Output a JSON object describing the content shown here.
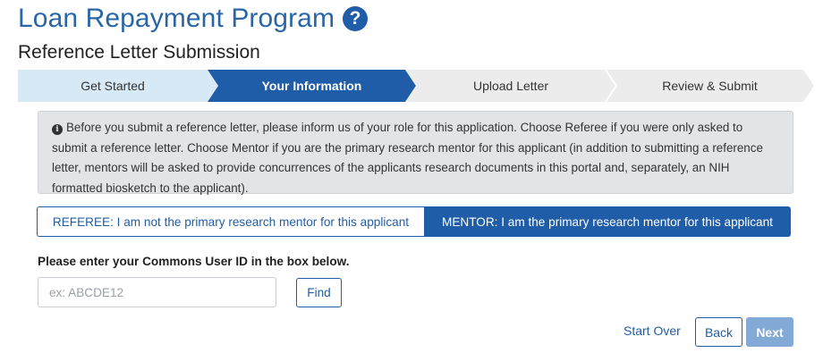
{
  "page": {
    "title": "Loan Repayment Program",
    "help_icon": "question-circle-icon",
    "subtitle": "Reference Letter Submission"
  },
  "stepper": {
    "steps": [
      {
        "label": "Get Started",
        "state": "completed"
      },
      {
        "label": "Your Information",
        "state": "active"
      },
      {
        "label": "Upload Letter",
        "state": "pending"
      },
      {
        "label": "Review & Submit",
        "state": "pending"
      }
    ],
    "colors": {
      "completed": "#d6e9f4",
      "active": "#1f5da8",
      "pending": "#ececec"
    }
  },
  "info": {
    "icon": "info-circle-icon",
    "text": "Before you submit a reference letter, please inform us of your role for this application. Choose Referee if you were only asked to submit a reference letter. Choose Mentor if you are the primary research mentor for this applicant (in addition to submitting a reference letter, mentors will be asked to provide concurrences of the applicants research documents in this portal and, separately, an NIH formatted biosketch to the applicant)."
  },
  "role": {
    "referee_label": "REFEREE: I am not the primary research mentor for this applicant",
    "mentor_label": "MENTOR: I am the primary research mentor for this applicant",
    "selected": "mentor"
  },
  "lookup": {
    "prompt": "Please enter your Commons User ID in the box below.",
    "input_value": "",
    "placeholder": "ex: ABCDE12",
    "find_label": "Find"
  },
  "nav": {
    "start_over_label": "Start Over",
    "back_label": "Back",
    "next_label": "Next"
  },
  "colors": {
    "brand": "#1f5da8",
    "title": "#2a66a6",
    "next_disabled": "#83a9d6"
  }
}
